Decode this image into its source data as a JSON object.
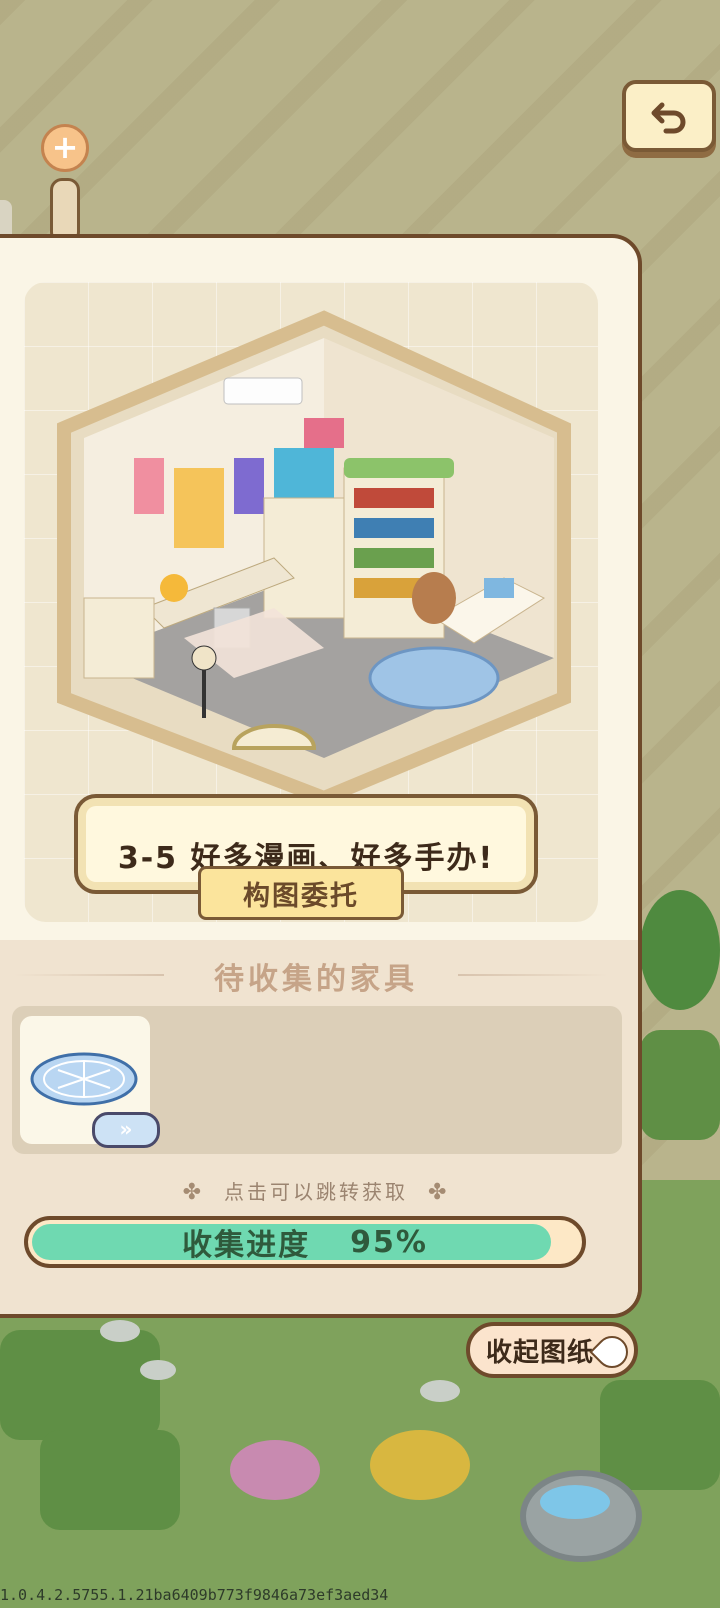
{
  "scene": {
    "title": "3-5 好多漫画、好多手办!",
    "subtitle": "构图委托"
  },
  "collect": {
    "section_title": "待收集的家具",
    "items": [
      {
        "name": "blue-round-rug",
        "go_icon": "double-chevron-right-icon"
      }
    ],
    "hint": "点击可以跳转获取",
    "progress_label": "收集进度",
    "progress_value": "95%",
    "progress_fraction": 0.95
  },
  "controls": {
    "back_icon": "undo-arrow-icon",
    "zoom_icon": "plus-icon",
    "collapse_label": "收起图纸"
  },
  "footer": {
    "version": "1.0.4.2.5755.1.21ba6409b773f9846a73ef3aed34"
  },
  "colors": {
    "panel_border": "#6e4a2b",
    "progress_fill": "#6fd9b1",
    "panel_bg": "#faf5e6"
  }
}
